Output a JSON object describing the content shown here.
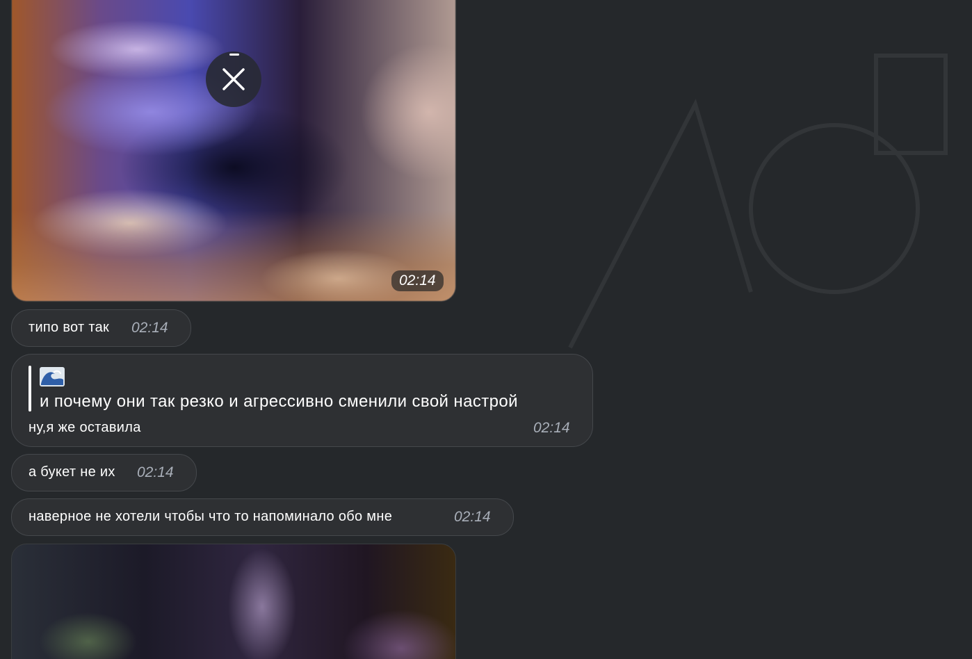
{
  "messages": {
    "photo_top": {
      "time": "02:14",
      "icon": "close-icon"
    },
    "m1": {
      "text": "типо вот так",
      "time": "02:14"
    },
    "m2": {
      "quote_emoji": "wave-emoji",
      "quote_text": "и почему они так резко и агрессивно сменили свой настрой",
      "text": "ну,я же оставила",
      "time": "02:14"
    },
    "m3": {
      "text": "а букет не их",
      "time": "02:14"
    },
    "m4": {
      "text": "наверное не хотели чтобы что то напоминало обо мне",
      "time": "02:14"
    },
    "photo_bottom": {}
  },
  "colors": {
    "background": "#25282b",
    "bubble": "#2e3033",
    "bubble_border": "#45484c",
    "time": "#a9afb9"
  }
}
